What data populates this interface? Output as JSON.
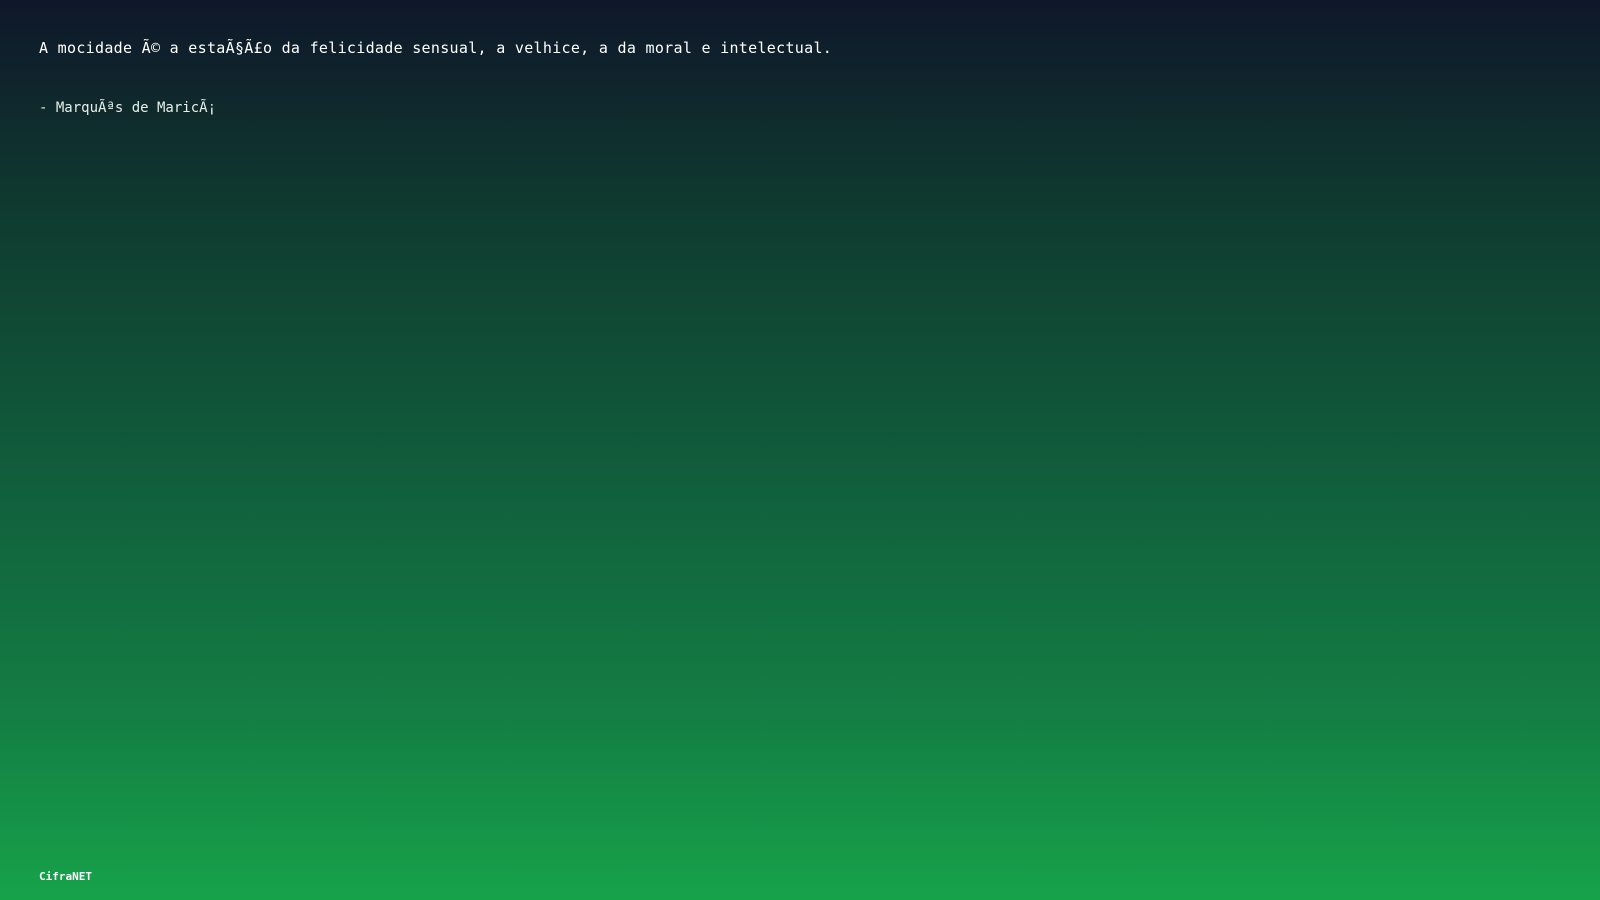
{
  "quote": {
    "text": "A mocidade Ã© a estaÃ§Ã£o da felicidade sensual, a velhice, a da moral e intelectual.",
    "author": "- MarquÃªs de MaricÃ¡"
  },
  "brand": {
    "name": "CifraNET"
  },
  "colors": {
    "gradient_top": "#0f172a",
    "gradient_bottom": "#16a34a",
    "text": "#ffffff"
  }
}
